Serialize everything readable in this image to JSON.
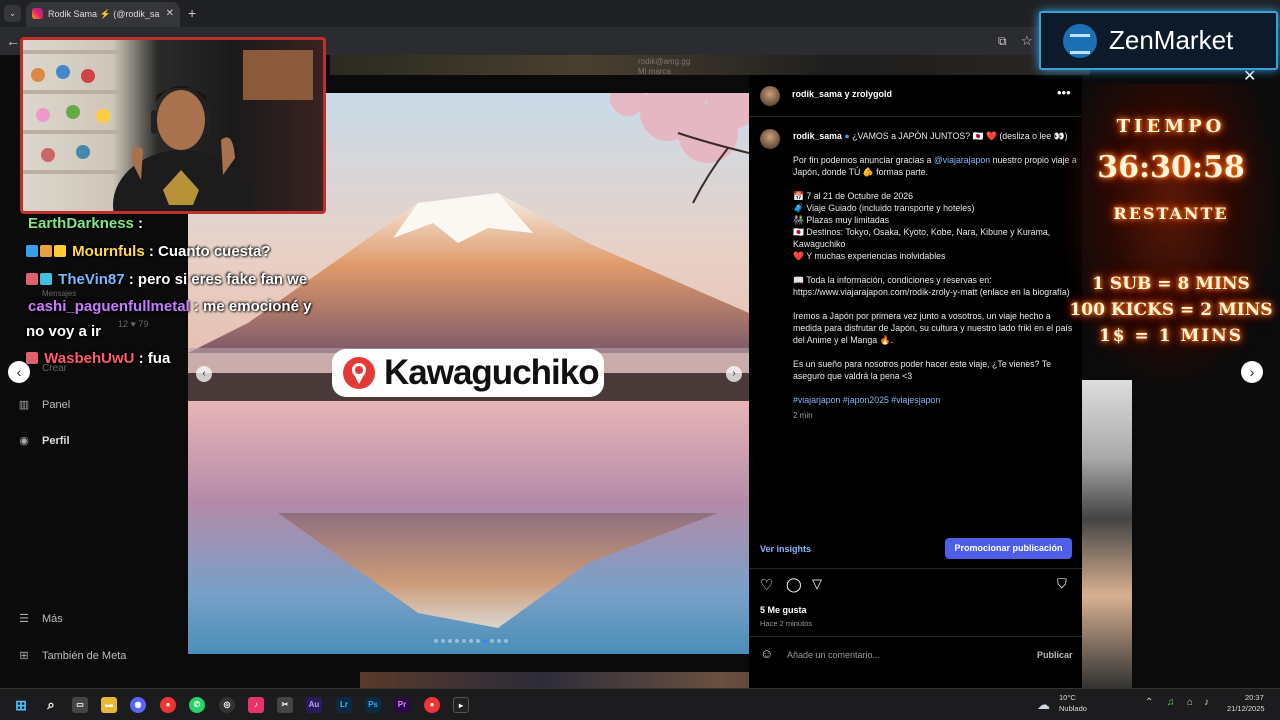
{
  "browser": {
    "tab_title": "Rodik Sama ⚡ (@rodik_sa",
    "tab_close": "✕",
    "new_tab": "+"
  },
  "sidebar": {
    "panel": "Panel",
    "perfil": "Perfil",
    "mas": "Más",
    "tambien_de_meta": "También de Meta",
    "crear": "Crear",
    "mensajes": "Mensajes",
    "stats": "12  ♥ 79"
  },
  "background_text": "rodik@amg.gg\nMi marca",
  "post": {
    "location_badge": "Kawaguchiko",
    "header_names": "rodik_sama y zrolygold",
    "caption": {
      "username": "rodik_sama",
      "headline": "¿VAMOS a JAPÓN JUNTOS? 🇯🇵 ❤️ (desliza o lee 👀)",
      "p1_pre": "Por fin podemos anunciar gracias a ",
      "p1_mention": "@viajarajapon",
      "p1_post": " nuestro propio viaje a Japón, donde TÚ 🫵 formas parte.",
      "l1": "📅 7 al 21 de Octubre de 2026",
      "l2": "🧳 Viaje Guiado (incluido transporte y hoteles)",
      "l3": "👫 Plazas muy limitadas",
      "l4": "🇯🇵 Destinos: Tokyo, Osaka, Kyoto, Kobe, Nara, Kibune y Kurama, Kawaguchiko",
      "l5": "❤️ Y muchas experiencias inolvidables",
      "p3": "📖 Toda la información, condiciones y reservas en: https://www.viajarajapon.com/rodik-zroly-y-matt (enlace en la biografía)",
      "p4": "Iremos a Japón por primera vez junto a vosotros, un viaje hecho a medida para disfrutar de Japón, su cultura y nuestro lado friki en el país del Anime y el Manga 🔥.",
      "p5": "Es un sueño para nosotros poder hacer este viaje, ¿Te vienes? Te aseguro que valdrá la pena <3",
      "tags": "#viajarjapon #japon2025 #viajesjapon",
      "time": "2 min"
    },
    "insights": "Ver insights",
    "promote": "Promocionar publicación",
    "likes": "5 Me gusta",
    "ago": "Hace 2 minutos",
    "comment_placeholder": "Añade un comentario...",
    "publish": "Publicar",
    "carousel_total": 11,
    "carousel_active": 8
  },
  "stream": {
    "chat": [
      {
        "user": "EarthDarkness",
        "msg": " : "
      },
      {
        "user": "Mournfuls",
        "msg": " : Cuanto cuesta?"
      },
      {
        "user": "TheVin87",
        "msg": " : pero si eres fake fan we"
      },
      {
        "user": "cashi_paguenfullmetal",
        "msg": " : me emocioné y"
      },
      {
        "user": "",
        "msg": "no voy a ir"
      },
      {
        "user": "WasbehUwU",
        "msg": " : fua"
      }
    ],
    "sponsor": "ZenMarket",
    "timer": {
      "title": "TIEMPO",
      "time": "36:30:58",
      "label": "RESTANTE",
      "rule1": "1 SUB = 8 MINS",
      "rule2": "100 KICKS = 2 MINS",
      "rule3": "1$ = 1 MINS"
    }
  },
  "taskbar": {
    "weather_temp": "10°C",
    "weather_desc": "Nublado",
    "time": "20:37",
    "date": "21/12/2025"
  },
  "colors": {
    "accent": "#4f5ee8",
    "link": "#8ab4f8",
    "webcam_border": "#c0302a",
    "zen_border": "#3aa0d8"
  }
}
